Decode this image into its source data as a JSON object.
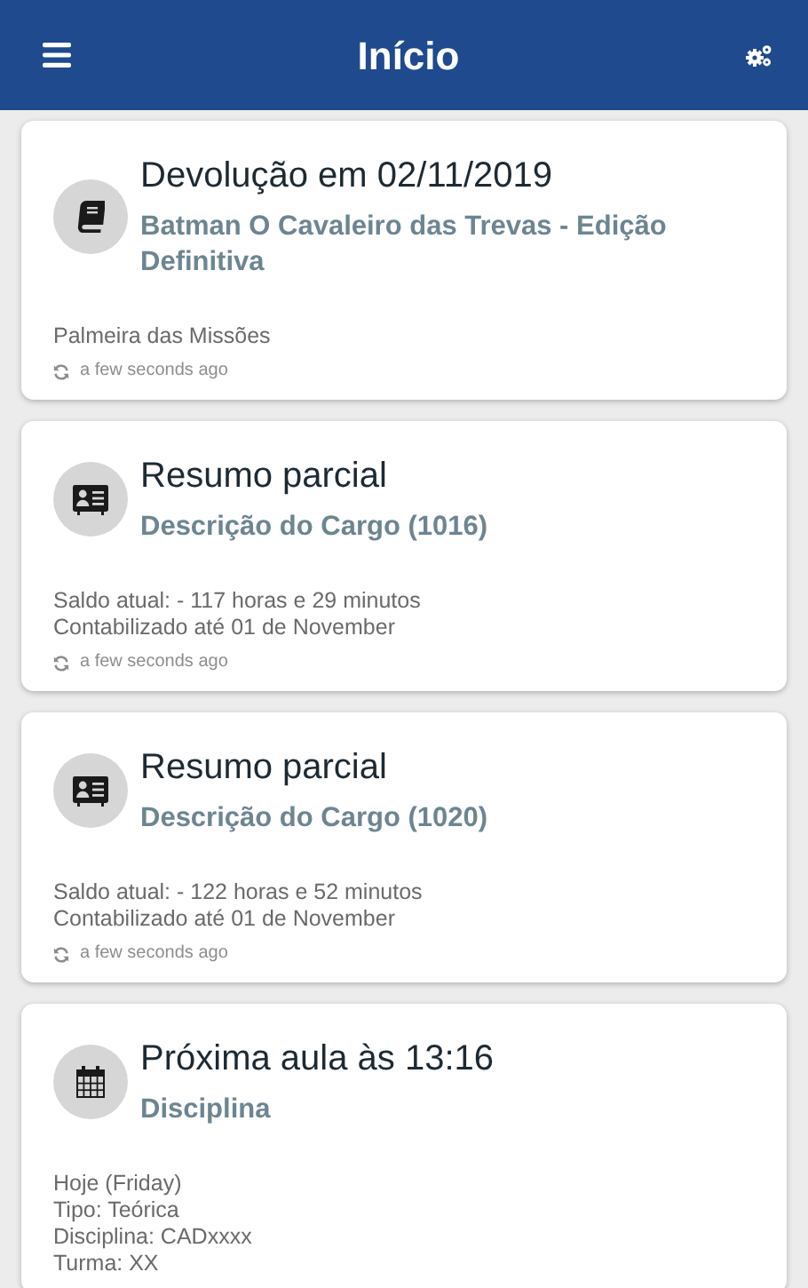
{
  "header": {
    "title": "Início"
  },
  "cards": [
    {
      "kind": "loan",
      "title": "Devolução em 02/11/2019",
      "subtitle": "Batman O Cavaleiro das Trevas - Edição Definitiva",
      "details": [
        "Palmeira das Missões"
      ],
      "updated": "a few seconds ago"
    },
    {
      "kind": "balance",
      "title": "Resumo parcial",
      "subtitle": "Descrição do Cargo (1016)",
      "details": [
        "Saldo atual: - 117 horas e 29 minutos",
        "Contabilizado até 01 de November"
      ],
      "updated": "a few seconds ago"
    },
    {
      "kind": "balance",
      "title": "Resumo parcial",
      "subtitle": "Descrição do Cargo (1020)",
      "details": [
        "Saldo atual: - 122 horas e 52 minutos",
        "Contabilizado até 01 de November"
      ],
      "updated": "a few seconds ago"
    },
    {
      "kind": "class",
      "title": "Próxima aula às 13:16",
      "subtitle": "Disciplina",
      "details": [
        "Hoje (Friday)",
        "Tipo: Teórica",
        "Disciplina: CADxxxx",
        "Turma: XX"
      ]
    }
  ]
}
